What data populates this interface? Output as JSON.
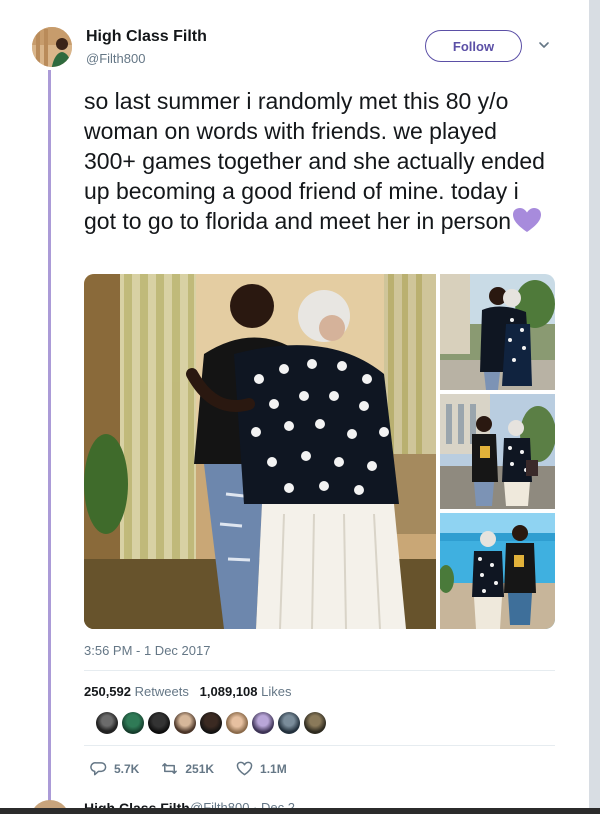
{
  "tweet": {
    "author": {
      "display_name": "High Class Filth",
      "handle": "@Filth800"
    },
    "follow_label": "Follow",
    "text": "so last summer i randomly met this 80 y/o woman on words with friends. we played 300+ games together and she actually ended up becoming a good friend of mine. today i got to go to florida and meet her in person",
    "emoji": "purple-heart",
    "timestamp": "3:56 PM - 1 Dec 2017",
    "retweets_count": "250,592",
    "retweets_label": "Retweets",
    "likes_count": "1,089,108",
    "likes_label": "Likes",
    "liker_avatar_count": 9,
    "actions": {
      "reply_count": "5.7K",
      "retweet_count": "251K",
      "like_count": "1.1M"
    },
    "icons": [
      "avatar",
      "chevron-down-icon",
      "reply-icon",
      "retweet-icon",
      "heart-icon"
    ]
  },
  "next_tweet": {
    "display_name": "High Class Filth",
    "meta": "@Filth800 · Dec 2"
  },
  "colors": {
    "accent": "#5b4fa6",
    "thread_line": "#ab9bd7",
    "heart_emoji": "#a78bdc",
    "muted_text": "#657786"
  }
}
